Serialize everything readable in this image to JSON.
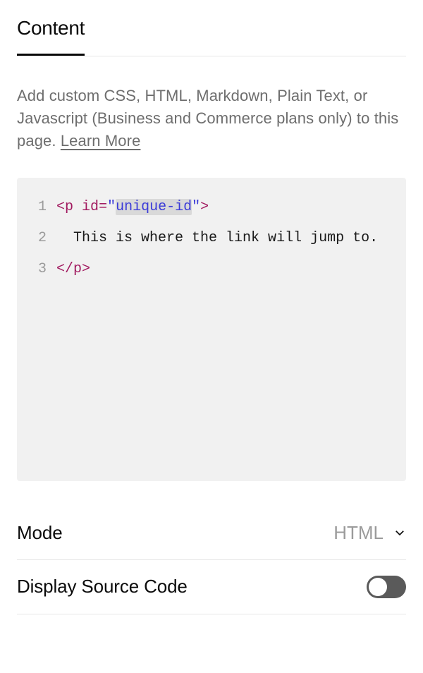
{
  "tab": {
    "label": "Content"
  },
  "description": {
    "text": "Add custom CSS, HTML, Markdown, Plain Text, or Javascript (Business and Commerce plans only) to this page. ",
    "learn_more_label": "Learn More"
  },
  "code": {
    "lines": [
      {
        "num": "1"
      },
      {
        "num": "2"
      },
      {
        "num": "3"
      }
    ],
    "line1": {
      "tag_open": "<",
      "tag_name": "p",
      "space": " ",
      "attr_name": "id",
      "equals": "=",
      "quote1": "\"",
      "attr_value": "unique-id",
      "quote2": "\"",
      "tag_close": ">"
    },
    "line2": {
      "indent": "  ",
      "text": "This is where the link will jump to."
    },
    "line3": {
      "tag_open": "</",
      "tag_name": "p",
      "tag_close": ">"
    }
  },
  "mode": {
    "label": "Mode",
    "value": "HTML"
  },
  "display_source": {
    "label": "Display Source Code",
    "enabled": false
  }
}
